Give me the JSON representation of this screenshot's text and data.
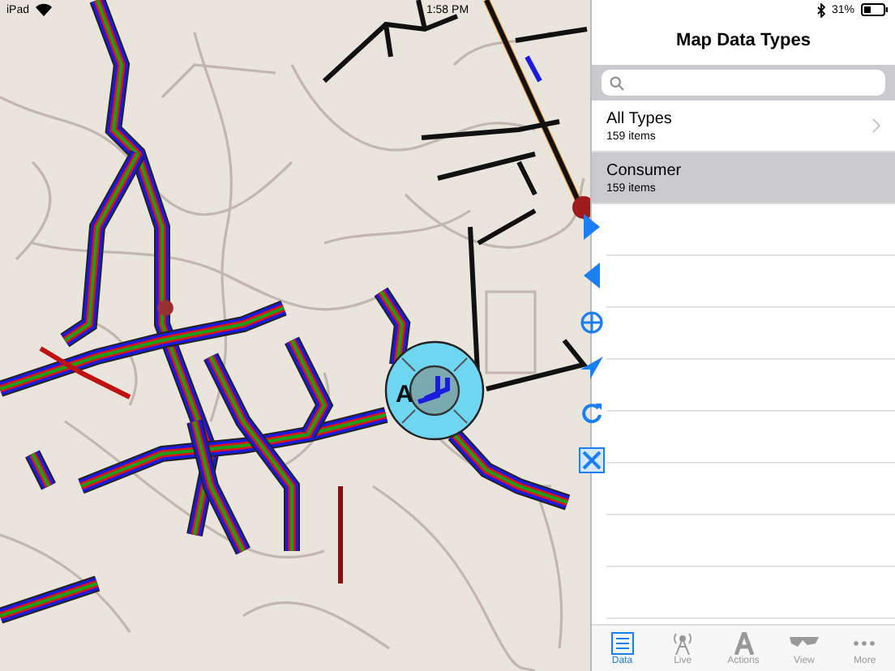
{
  "status_bar": {
    "device": "iPad",
    "time": "1:58 PM",
    "battery": "31%"
  },
  "map": {
    "marker_label": "A"
  },
  "panel": {
    "title": "Map Data Types",
    "items": [
      {
        "name": "All Types",
        "count": "159 items",
        "selected": false
      },
      {
        "name": "Consumer",
        "count": "159 items",
        "selected": true
      }
    ]
  },
  "tab_bar": [
    {
      "label": "Data",
      "selected": true,
      "kind": "data"
    },
    {
      "label": "Live",
      "selected": false,
      "kind": "live"
    },
    {
      "label": "Actions",
      "selected": false,
      "kind": "actions"
    },
    {
      "label": "View",
      "selected": false,
      "kind": "view"
    },
    {
      "label": "More",
      "selected": false,
      "kind": "more"
    }
  ]
}
